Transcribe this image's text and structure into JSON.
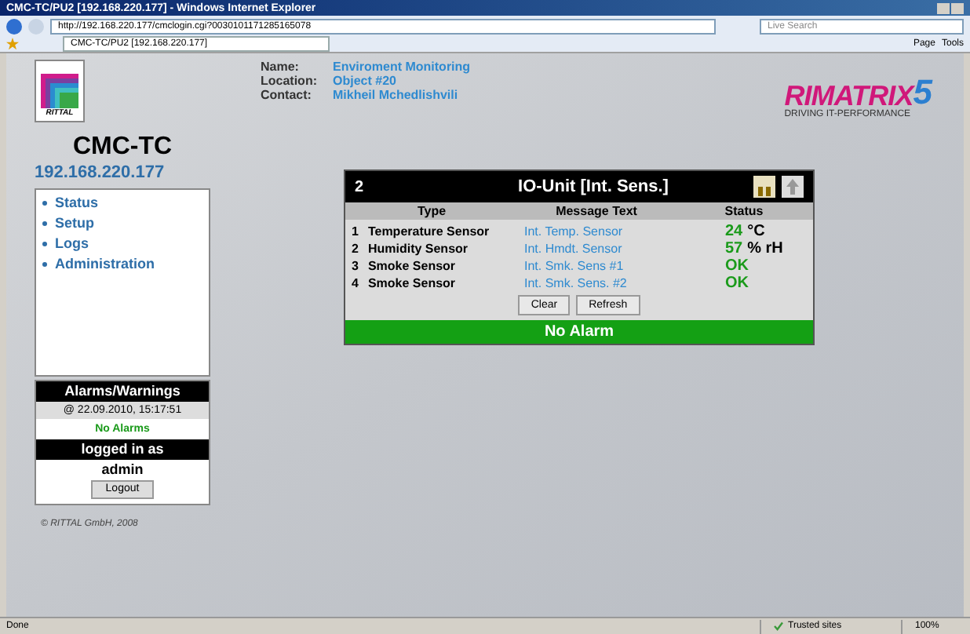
{
  "window": {
    "title": "CMC-TC/PU2 [192.168.220.177] - Windows Internet Explorer"
  },
  "address_bar": {
    "url": "http://192.168.220.177/cmclogin.cgi?0030101171285165078",
    "search_placeholder": "Live Search"
  },
  "tabs": [
    {
      "label": "CMC-TC/PU2 [192.168.220.177]",
      "selected": true
    }
  ],
  "toolbar": [
    "Page",
    "Tools"
  ],
  "logo": {
    "text": "RITTAL"
  },
  "device": {
    "name": "CMC-TC",
    "ip": "192.168.220.177"
  },
  "info": [
    {
      "label": "Name:",
      "value": "Enviroment Monitoring"
    },
    {
      "label": "Location:",
      "value": "Object #20"
    },
    {
      "label": "Contact:",
      "value": "Mikheil Mchedlishvili"
    }
  ],
  "brand": {
    "name": "RIMATRIX",
    "digit": "5",
    "tagline": "DRIVING IT-PERFORMANCE"
  },
  "nav": [
    "Status",
    "Setup",
    "Logs",
    "Administration"
  ],
  "alarms": {
    "title": "Alarms/Warnings",
    "timestamp": "@ 22.09.2010, 15:17:51",
    "status": "No Alarms"
  },
  "login": {
    "title": "logged in as",
    "user": "admin",
    "button": "Logout"
  },
  "copyright": "© RITTAL GmbH, 2008",
  "panel": {
    "number": "2",
    "title": "IO-Unit [Int. Sens.]",
    "columns": [
      "Type",
      "Message Text",
      "Status"
    ],
    "rows": [
      {
        "index": "1",
        "type": "Temperature Sensor",
        "message": "Int. Temp. Sensor",
        "value": "24",
        "unit": "°C"
      },
      {
        "index": "2",
        "type": "Humidity Sensor",
        "message": "Int. Hmdt. Sensor",
        "value": "57",
        "unit": "% rH"
      },
      {
        "index": "3",
        "type": "Smoke Sensor",
        "message": "Int. Smk. Sens #1",
        "value": "OK"
      },
      {
        "index": "4",
        "type": "Smoke Sensor",
        "message": "Int. Smk. Sens. #2",
        "value": "OK"
      }
    ],
    "buttons": [
      "Clear",
      "Refresh"
    ],
    "footer": "No Alarm"
  },
  "status_bar": {
    "text": "Done",
    "zone": "Trusted sites",
    "zoom": "100%"
  }
}
